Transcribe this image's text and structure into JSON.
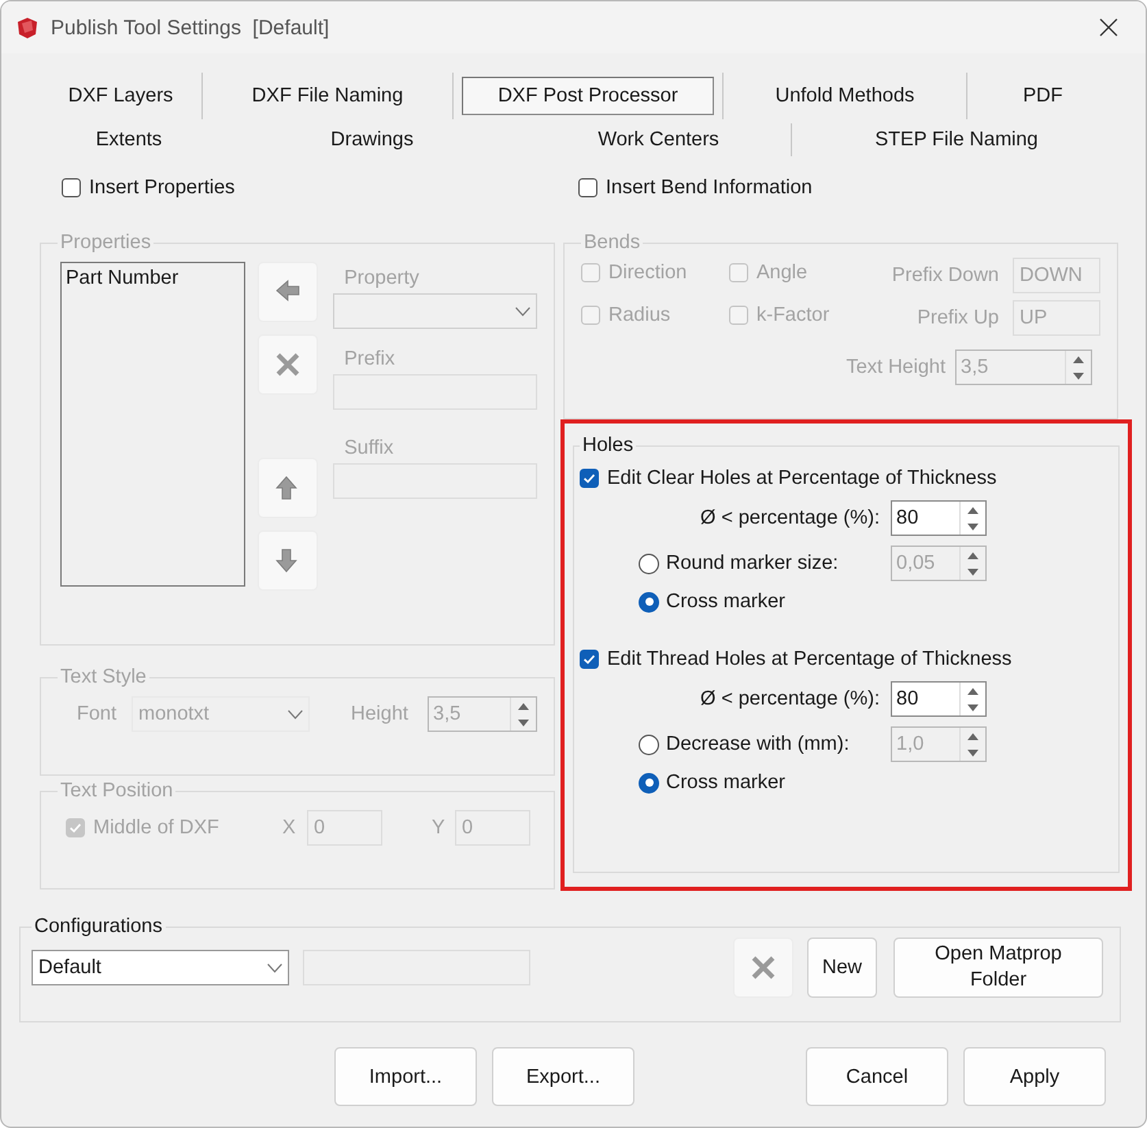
{
  "window": {
    "title": "Publish Tool Settings  [Default]"
  },
  "tab_rows": [
    {
      "tabs": [
        {
          "label": "DXF Layers",
          "selected": false
        },
        {
          "label": "DXF File Naming",
          "selected": false
        },
        {
          "label": "DXF Post Processor",
          "selected": true
        },
        {
          "label": "Unfold Methods",
          "selected": false
        },
        {
          "label": "PDF",
          "selected": false
        }
      ]
    },
    {
      "tabs": [
        {
          "label": "Extents",
          "selected": false
        },
        {
          "label": "Drawings",
          "selected": false
        },
        {
          "label": "Work Centers",
          "selected": false
        },
        {
          "label": "STEP File Naming",
          "selected": false
        }
      ]
    }
  ],
  "insert_properties": {
    "label": "Insert Properties",
    "checked": false
  },
  "insert_bend_information": {
    "label": "Insert Bend Information",
    "checked": false
  },
  "properties": {
    "title": "Properties",
    "disabled": true,
    "list_items": [
      "Part Number"
    ],
    "property": {
      "label": "Property"
    },
    "prefix": {
      "label": "Prefix"
    },
    "suffix": {
      "label": "Suffix"
    }
  },
  "bends": {
    "title": "Bends",
    "disabled": true,
    "checkboxes": [
      {
        "label": "Direction",
        "checked": false
      },
      {
        "label": "Angle",
        "checked": false
      },
      {
        "label": "Radius",
        "checked": false
      },
      {
        "label": "k-Factor",
        "checked": false
      }
    ],
    "prefix_down": {
      "label": "Prefix Down",
      "value": "DOWN"
    },
    "prefix_up": {
      "label": "Prefix Up",
      "value": "UP"
    },
    "text_height": {
      "label": "Text Height",
      "value": "3,5"
    }
  },
  "holes": {
    "title": "Holes",
    "highlighted": true,
    "sections": [
      {
        "label": "Edit Clear Holes at Percentage of Thickness",
        "checked": true,
        "percentage": {
          "label": "Ø < percentage (%):",
          "value": "80"
        },
        "options": [
          {
            "label": "Round marker size:",
            "selected": false,
            "value": "0,05"
          },
          {
            "label": "Cross marker",
            "selected": true
          }
        ]
      },
      {
        "label": "Edit Thread Holes at Percentage of Thickness",
        "checked": true,
        "percentage": {
          "label": "Ø < percentage (%):",
          "value": "80"
        },
        "options": [
          {
            "label": "Decrease with (mm):",
            "selected": false,
            "value": "1,0"
          },
          {
            "label": "Cross marker",
            "selected": true
          }
        ]
      }
    ]
  },
  "text_style": {
    "title": "Text Style",
    "disabled": true,
    "font": {
      "label": "Font",
      "value": "monotxt"
    },
    "height": {
      "label": "Height",
      "value": "3,5"
    }
  },
  "text_position": {
    "title": "Text Position",
    "disabled": true,
    "middle": {
      "label": "Middle of DXF",
      "checked": true
    },
    "x": {
      "label": "X",
      "value": "0"
    },
    "y": {
      "label": "Y",
      "value": "0"
    }
  },
  "configurations": {
    "title": "Configurations",
    "value": "Default",
    "buttons": [
      "New",
      "Open Matprop Folder"
    ]
  },
  "footer_buttons": [
    {
      "label": "Import..."
    },
    {
      "label": "Export..."
    },
    {
      "label": "Cancel"
    },
    {
      "label": "Apply"
    }
  ]
}
